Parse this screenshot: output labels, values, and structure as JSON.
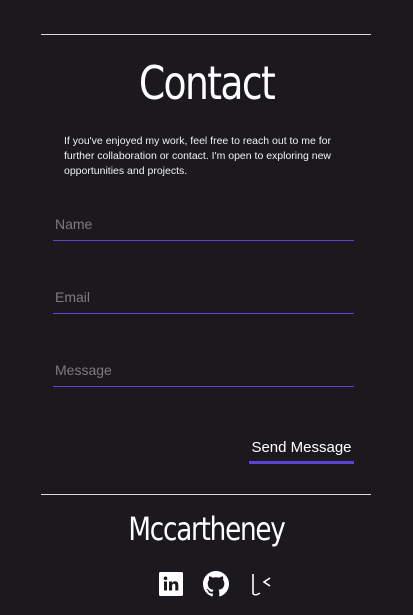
{
  "contact": {
    "title": "Contact",
    "intro": "If you've enjoyed my work, feel free to reach out to me for further collaboration or contact. I'm open to exploring new opportunities and projects.",
    "name_placeholder": "Name",
    "email_placeholder": "Email",
    "message_placeholder": "Message",
    "send_label": "Send Message"
  },
  "footer": {
    "brand": "Mccartheney",
    "socials": [
      {
        "icon": "linkedin-icon"
      },
      {
        "icon": "github-icon"
      },
      {
        "icon": "kaggle-icon"
      }
    ]
  },
  "colors": {
    "background": "#1b191e",
    "accent": "#5b43d6",
    "text": "#ffffff"
  }
}
